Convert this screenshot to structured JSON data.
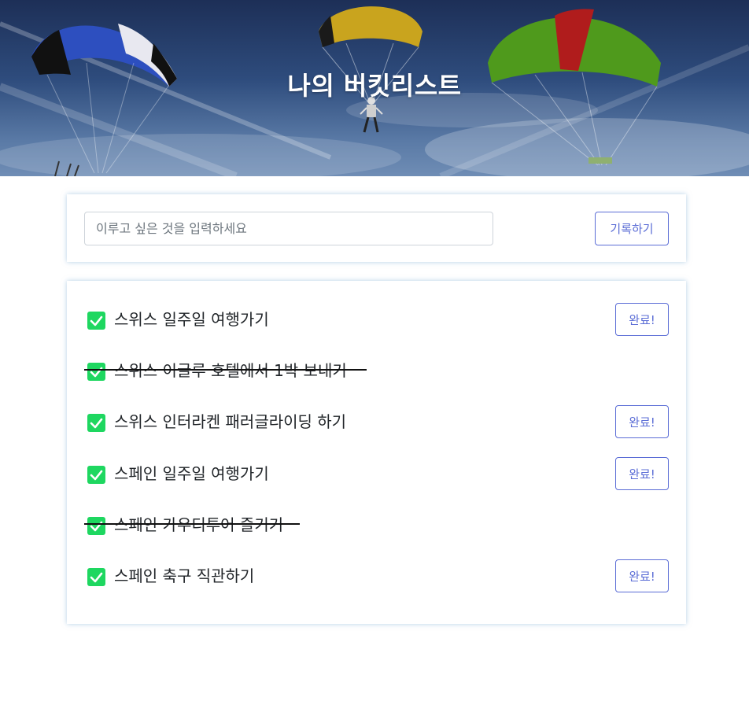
{
  "header": {
    "title": "나의 버킷리스트"
  },
  "form": {
    "input_placeholder": "이루고 싶은 것을 입력하세요",
    "input_value": "",
    "submit_label": "기록하기"
  },
  "colors": {
    "accent": "#5b6dd6",
    "check": "#1ed760",
    "strike": "#111111"
  },
  "list": {
    "items": [
      {
        "text": "스위스 일주일 여행가기",
        "done": false,
        "done_label": "완료!"
      },
      {
        "text": "스위스 이글루 호텔에서 1박 보내기",
        "done": true
      },
      {
        "text": "스위스 인터라켄 패러글라이딩 하기",
        "done": false,
        "done_label": "완료!"
      },
      {
        "text": "스페인 일주일 여행가기",
        "done": false,
        "done_label": "완료!"
      },
      {
        "text": "스페인 가우디투어 즐기기",
        "done": true
      },
      {
        "text": "스페인 축구 직관하기",
        "done": false,
        "done_label": "완료!"
      }
    ]
  }
}
